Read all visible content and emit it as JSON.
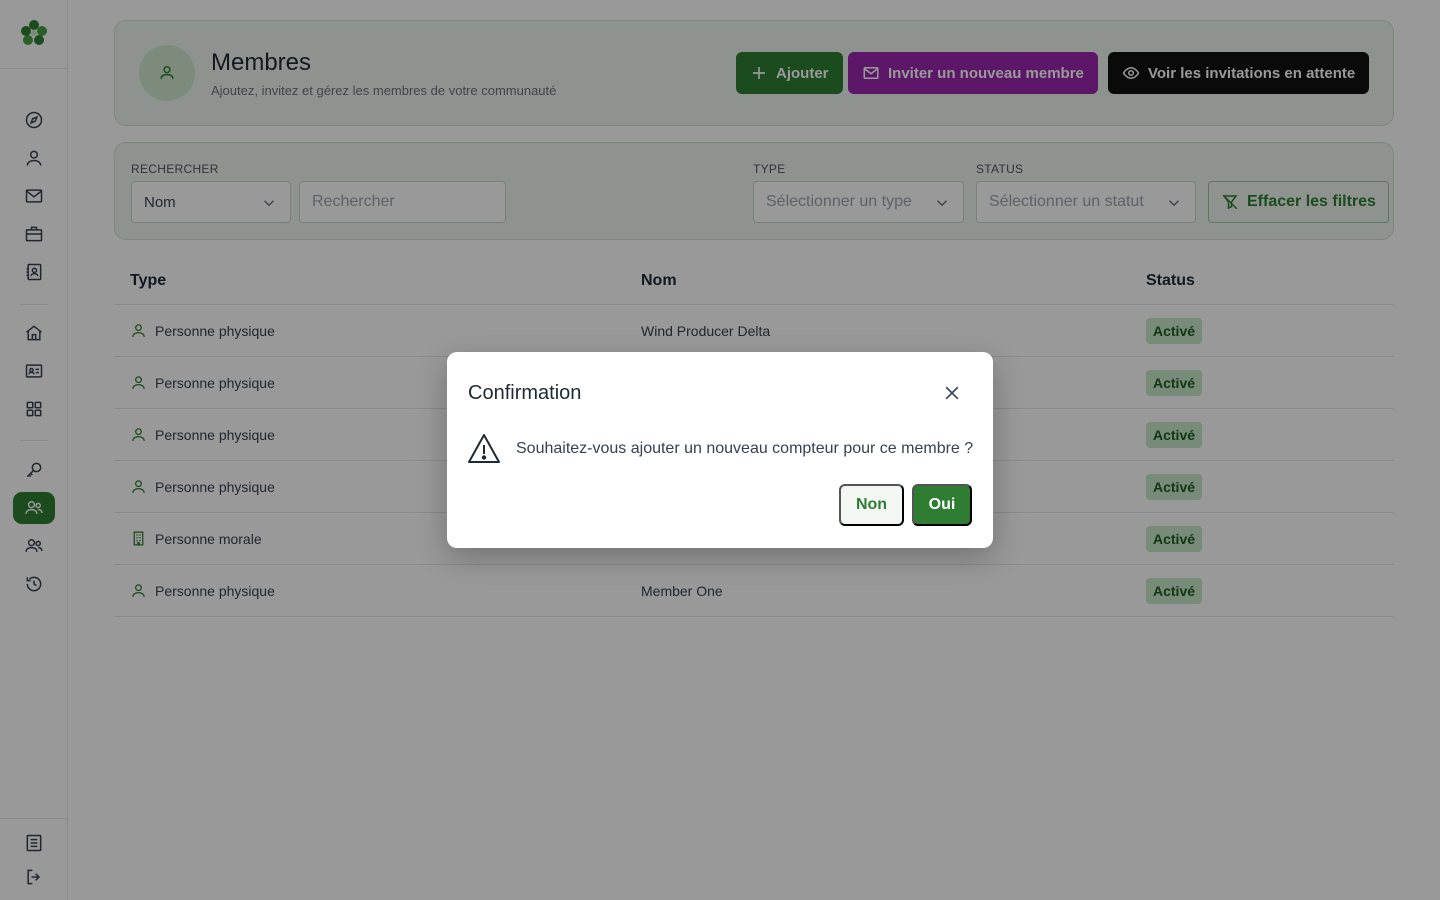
{
  "header": {
    "title": "Membres",
    "subtitle": "Ajoutez, invitez et gérez les membres de votre communauté",
    "add_label": "Ajouter",
    "invite_label": "Inviter un nouveau membre",
    "pending_label": "Voir les invitations en attente"
  },
  "filters": {
    "search_label": "RECHERCHER",
    "search_field_value": "Nom",
    "search_placeholder": "Rechercher",
    "type_label": "TYPE",
    "type_placeholder": "Sélectionner un type",
    "status_label": "STATUS",
    "status_placeholder": "Sélectionner un statut",
    "clear_label": "Effacer les filtres"
  },
  "table": {
    "columns": [
      "Type",
      "Nom",
      "Status"
    ],
    "rows": [
      {
        "type": "Personne physique",
        "type_icon": "person-icon",
        "name": "Wind Producer Delta",
        "status": "Activé"
      },
      {
        "type": "Personne physique",
        "type_icon": "person-icon",
        "name": "",
        "status": "Activé"
      },
      {
        "type": "Personne physique",
        "type_icon": "person-icon",
        "name": "",
        "status": "Activé"
      },
      {
        "type": "Personne physique",
        "type_icon": "person-icon",
        "name": "",
        "status": "Activé"
      },
      {
        "type": "Personne morale",
        "type_icon": "building-icon",
        "name": "",
        "status": "Activé"
      },
      {
        "type": "Personne physique",
        "type_icon": "person-icon",
        "name": "Member One",
        "status": "Activé"
      }
    ]
  },
  "dialog": {
    "title": "Confirmation",
    "message": "Souhaitez-vous ajouter un nouveau compteur pour ce membre ?",
    "no_label": "Non",
    "yes_label": "Oui"
  },
  "colors": {
    "primary_green": "#2e7d32",
    "invite_purple": "#9c27b0",
    "pending_black": "#111111",
    "badge_bg": "#c8e6c9"
  },
  "sidebar": {
    "icons": [
      "compass-icon",
      "user-icon",
      "mail-icon",
      "briefcase-icon",
      "contacts-icon",
      "home-icon",
      "id-card-icon",
      "grid-icon",
      "key-icon",
      "members-icon",
      "group-icon",
      "history-icon",
      "document-icon",
      "logout-icon"
    ],
    "active": "members-icon"
  }
}
